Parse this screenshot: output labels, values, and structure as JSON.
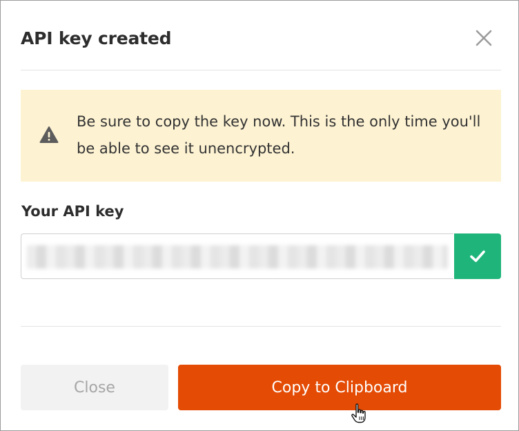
{
  "dialog": {
    "title": "API key created",
    "close_icon": "close-x-icon"
  },
  "alert": {
    "icon": "warning-triangle-icon",
    "text": "Be sure to copy the key now. This is the only time you'll be able to see it unencrypted."
  },
  "api_key": {
    "label": "Your API key",
    "value": "",
    "confirm_icon": "checkmark-icon"
  },
  "footer": {
    "close_label": "Close",
    "copy_label": "Copy to Clipboard"
  },
  "colors": {
    "alert_bg": "#fdf2d2",
    "confirm_green": "#1fb57a",
    "primary_orange": "#e44b04",
    "secondary_bg": "#f2f2f2"
  }
}
